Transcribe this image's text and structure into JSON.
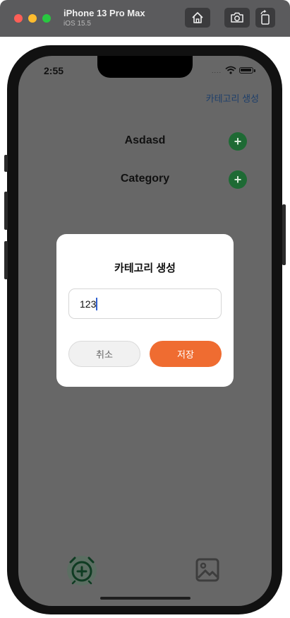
{
  "simulator": {
    "device_name": "iPhone 13 Pro Max",
    "os_version": "iOS 15.5",
    "toolbar_icons": [
      "home-icon",
      "camera-icon",
      "rotate-icon"
    ]
  },
  "status_bar": {
    "time": "2:55",
    "signal": "....",
    "icons": [
      "wifi-icon",
      "battery-icon"
    ]
  },
  "header": {
    "create_category_link": "카테고리 생성"
  },
  "categories": [
    {
      "name": "Asdasd",
      "add_icon": "plus-icon"
    },
    {
      "name": "Category",
      "add_icon": "plus-icon"
    }
  ],
  "dialog": {
    "title": "카테고리 생성",
    "input_value": "123",
    "cancel_label": "취소",
    "save_label": "저장"
  },
  "tab_bar": {
    "items": [
      {
        "icon": "alarm-add-icon",
        "active": true
      },
      {
        "icon": "photo-icon",
        "active": false
      }
    ]
  },
  "colors": {
    "accent_save": "#ef6c31",
    "plus_button": "#1e6a34",
    "link": "#1e3f6b",
    "dim_overlay": "#676767"
  }
}
